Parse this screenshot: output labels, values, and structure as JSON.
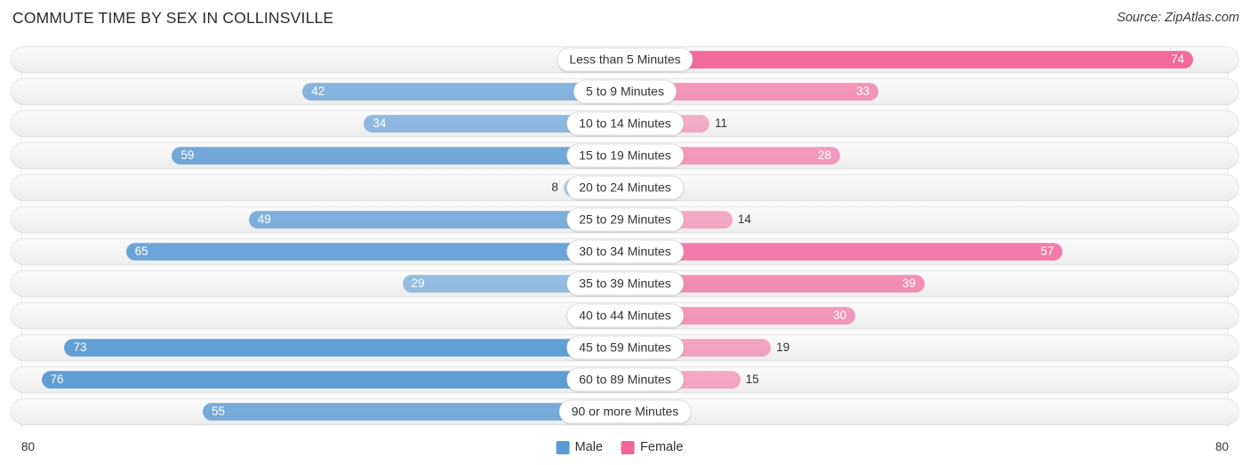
{
  "header": {
    "title": "COMMUTE TIME BY SEX IN COLLINSVILLE",
    "source": "Source: ZipAtlas.com"
  },
  "legend": {
    "male_label": "Male",
    "female_label": "Female",
    "male_color": "#5b9bd5",
    "female_color": "#f2639a"
  },
  "axis": {
    "left_tick": "80",
    "right_tick": "80"
  },
  "chart_data": {
    "type": "bar",
    "title": "COMMUTE TIME BY SEX IN COLLINSVILLE",
    "xlabel": "",
    "ylabel": "",
    "orientation": "horizontal-diverging",
    "axis_max": 80,
    "grid": false,
    "legend_position": "bottom-center",
    "categories": [
      "Less than 5 Minutes",
      "5 to 9 Minutes",
      "10 to 14 Minutes",
      "15 to 19 Minutes",
      "20 to 24 Minutes",
      "25 to 29 Minutes",
      "30 to 34 Minutes",
      "35 to 39 Minutes",
      "40 to 44 Minutes",
      "45 to 59 Minutes",
      "60 to 89 Minutes",
      "90 or more Minutes"
    ],
    "series": [
      {
        "name": "Male",
        "color": "#5b9bd5",
        "values": [
          0,
          42,
          34,
          59,
          8,
          49,
          65,
          29,
          4,
          73,
          76,
          55
        ]
      },
      {
        "name": "Female",
        "color": "#f2639a",
        "values": [
          74,
          33,
          11,
          28,
          4,
          14,
          57,
          39,
          30,
          19,
          15,
          0
        ]
      }
    ]
  }
}
